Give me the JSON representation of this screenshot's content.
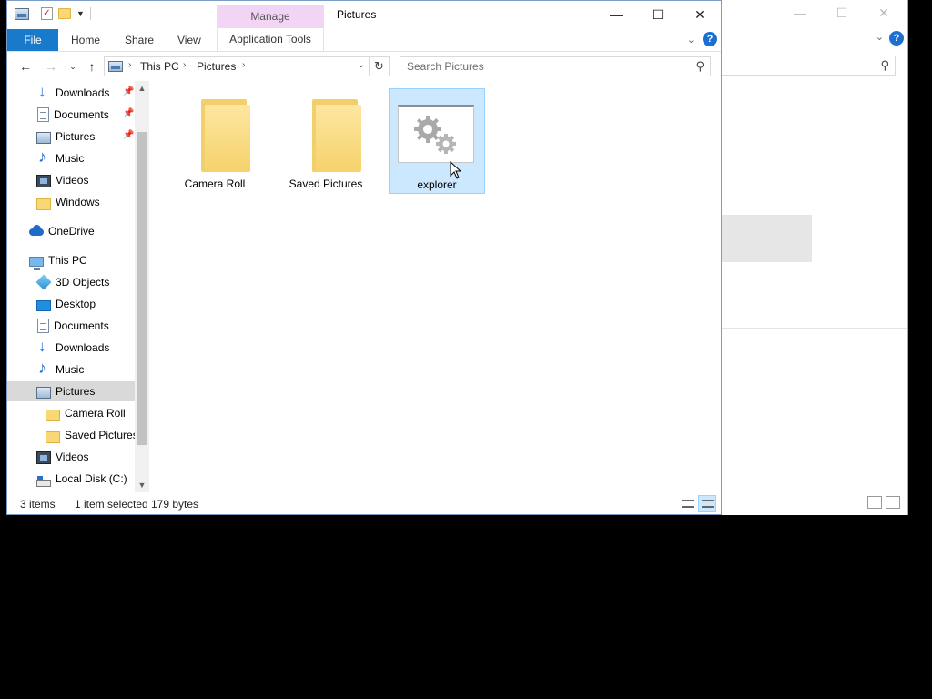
{
  "title": "Pictures",
  "ribbon": {
    "contextual_group": "Manage",
    "tabs": [
      "File",
      "Home",
      "Share",
      "View",
      "Application Tools"
    ]
  },
  "window_controls": {
    "minimize": "—",
    "maximize": "☐",
    "close": "✕"
  },
  "address": {
    "crumbs": [
      "This PC",
      "Pictures"
    ]
  },
  "search": {
    "placeholder": "Search Pictures"
  },
  "navpane": {
    "items": [
      {
        "label": "Downloads",
        "icon": "downloads-icon",
        "pinned": true
      },
      {
        "label": "Documents",
        "icon": "documents-icon",
        "pinned": true
      },
      {
        "label": "Pictures",
        "icon": "pictures-icon",
        "pinned": true
      },
      {
        "label": "Music",
        "icon": "music-icon",
        "pinned": false
      },
      {
        "label": "Videos",
        "icon": "videos-icon",
        "pinned": false
      },
      {
        "label": "Windows",
        "icon": "folder-icon",
        "pinned": false
      },
      {
        "label": "OneDrive",
        "icon": "onedrive-icon",
        "pinned": false
      },
      {
        "label": "This PC",
        "icon": "this-pc-icon",
        "pinned": false
      },
      {
        "label": "3D Objects",
        "icon": "3d-objects-icon",
        "pinned": false
      },
      {
        "label": "Desktop",
        "icon": "desktop-icon",
        "pinned": false
      },
      {
        "label": "Documents",
        "icon": "documents-icon",
        "pinned": false
      },
      {
        "label": "Downloads",
        "icon": "downloads-icon",
        "pinned": false
      },
      {
        "label": "Music",
        "icon": "music-icon",
        "pinned": false
      },
      {
        "label": "Pictures",
        "icon": "pictures-icon",
        "pinned": false,
        "selected": true
      },
      {
        "label": "Camera Roll",
        "icon": "folder-icon",
        "pinned": false
      },
      {
        "label": "Saved Pictures",
        "icon": "folder-icon",
        "pinned": false
      },
      {
        "label": "Videos",
        "icon": "videos-icon",
        "pinned": false
      },
      {
        "label": "Local Disk (C:)",
        "icon": "local-disk-icon",
        "pinned": false
      }
    ]
  },
  "files": [
    {
      "name": "Camera Roll",
      "icon": "folder-icon",
      "selected": false
    },
    {
      "name": "Saved Pictures",
      "icon": "folder-icon",
      "selected": false
    },
    {
      "name": "explorer",
      "icon": "settings-file-icon",
      "selected": true
    }
  ],
  "status": {
    "count": "3 items",
    "selection": "1 item selected",
    "size": "179 bytes"
  },
  "colors": {
    "file_tab": "#1979ca",
    "manage_tab": "#f2d5f5",
    "selection": "#cce8ff",
    "help": "#1c6fd1"
  }
}
